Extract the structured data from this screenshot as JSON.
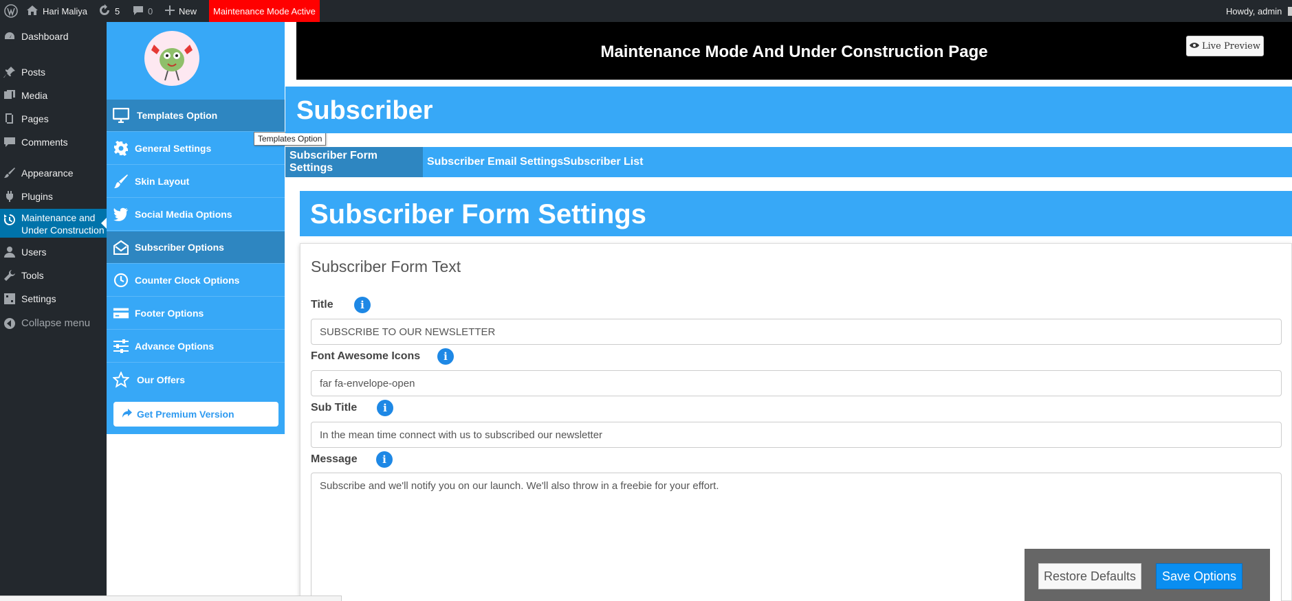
{
  "admin_bar": {
    "site_name": "Hari Maliya",
    "updates_count": "5",
    "comments_count": "0",
    "new_label": "New",
    "maintenance_badge": "Maintenance Mode Active",
    "howdy": "Howdy, admin"
  },
  "admin_menu": {
    "items": [
      {
        "label": "Dashboard",
        "icon": "dashboard-icon"
      },
      {
        "label": "Posts",
        "icon": "pin-icon"
      },
      {
        "label": "Media",
        "icon": "media-icon"
      },
      {
        "label": "Pages",
        "icon": "pages-icon"
      },
      {
        "label": "Comments",
        "icon": "comments-icon"
      },
      {
        "label": "Appearance",
        "icon": "brush-icon"
      },
      {
        "label": "Plugins",
        "icon": "plugin-icon"
      },
      {
        "label": "Maintenance and Under Construction",
        "icon": "history-icon"
      },
      {
        "label": "Users",
        "icon": "users-icon"
      },
      {
        "label": "Tools",
        "icon": "wrench-icon"
      },
      {
        "label": "Settings",
        "icon": "settings-icon"
      }
    ],
    "collapse_label": "Collapse menu"
  },
  "plugin_sidebar": {
    "items": [
      {
        "label": "Templates Option",
        "icon": "monitor-icon"
      },
      {
        "label": "General Settings",
        "icon": "gear-icon"
      },
      {
        "label": "Skin Layout",
        "icon": "paintbrush-icon"
      },
      {
        "label": "Social Media Options",
        "icon": "twitter-icon"
      },
      {
        "label": "Subscriber Options",
        "icon": "envelope-open-icon"
      },
      {
        "label": "Counter Clock Options",
        "icon": "clock-icon"
      },
      {
        "label": "Footer Options",
        "icon": "credit-card-icon"
      },
      {
        "label": "Advance Options",
        "icon": "sliders-icon"
      },
      {
        "label": "Our Offers",
        "icon": "star-icon"
      }
    ],
    "premium_label": "Get Premium Version"
  },
  "tooltip": "Templates Option",
  "header": {
    "title": "Maintenance Mode And Under Construction Page",
    "live_preview_label": "Live Preview"
  },
  "page_title": "Subscriber",
  "tabs": [
    {
      "label": "Subscriber Form Settings"
    },
    {
      "label": "Subscriber Email Settings"
    },
    {
      "label": "Subscriber List"
    }
  ],
  "section_title": "Subscriber Form Settings",
  "form": {
    "card_title": "Subscriber Form Text",
    "title_label": "Title",
    "title_value": "SUBSCRIBE TO OUR NEWSLETTER",
    "icons_label": "Font Awesome Icons",
    "icons_value": "far fa-envelope-open",
    "subtitle_label": "Sub Title",
    "subtitle_value": "In the mean time connect with us to subscribed our newsletter",
    "message_label": "Message",
    "message_value": "Subscribe and we'll notify you on our launch. We'll also throw in a freebie for your effort."
  },
  "actions": {
    "restore_label": "Restore Defaults",
    "save_label": "Save Options"
  },
  "colors": {
    "accent_blue": "#37a8f7",
    "active_blue": "#2e86c1",
    "admin_dark": "#23282d",
    "maintenance_red": "#ff0000",
    "save_blue": "#0a8ef0"
  }
}
